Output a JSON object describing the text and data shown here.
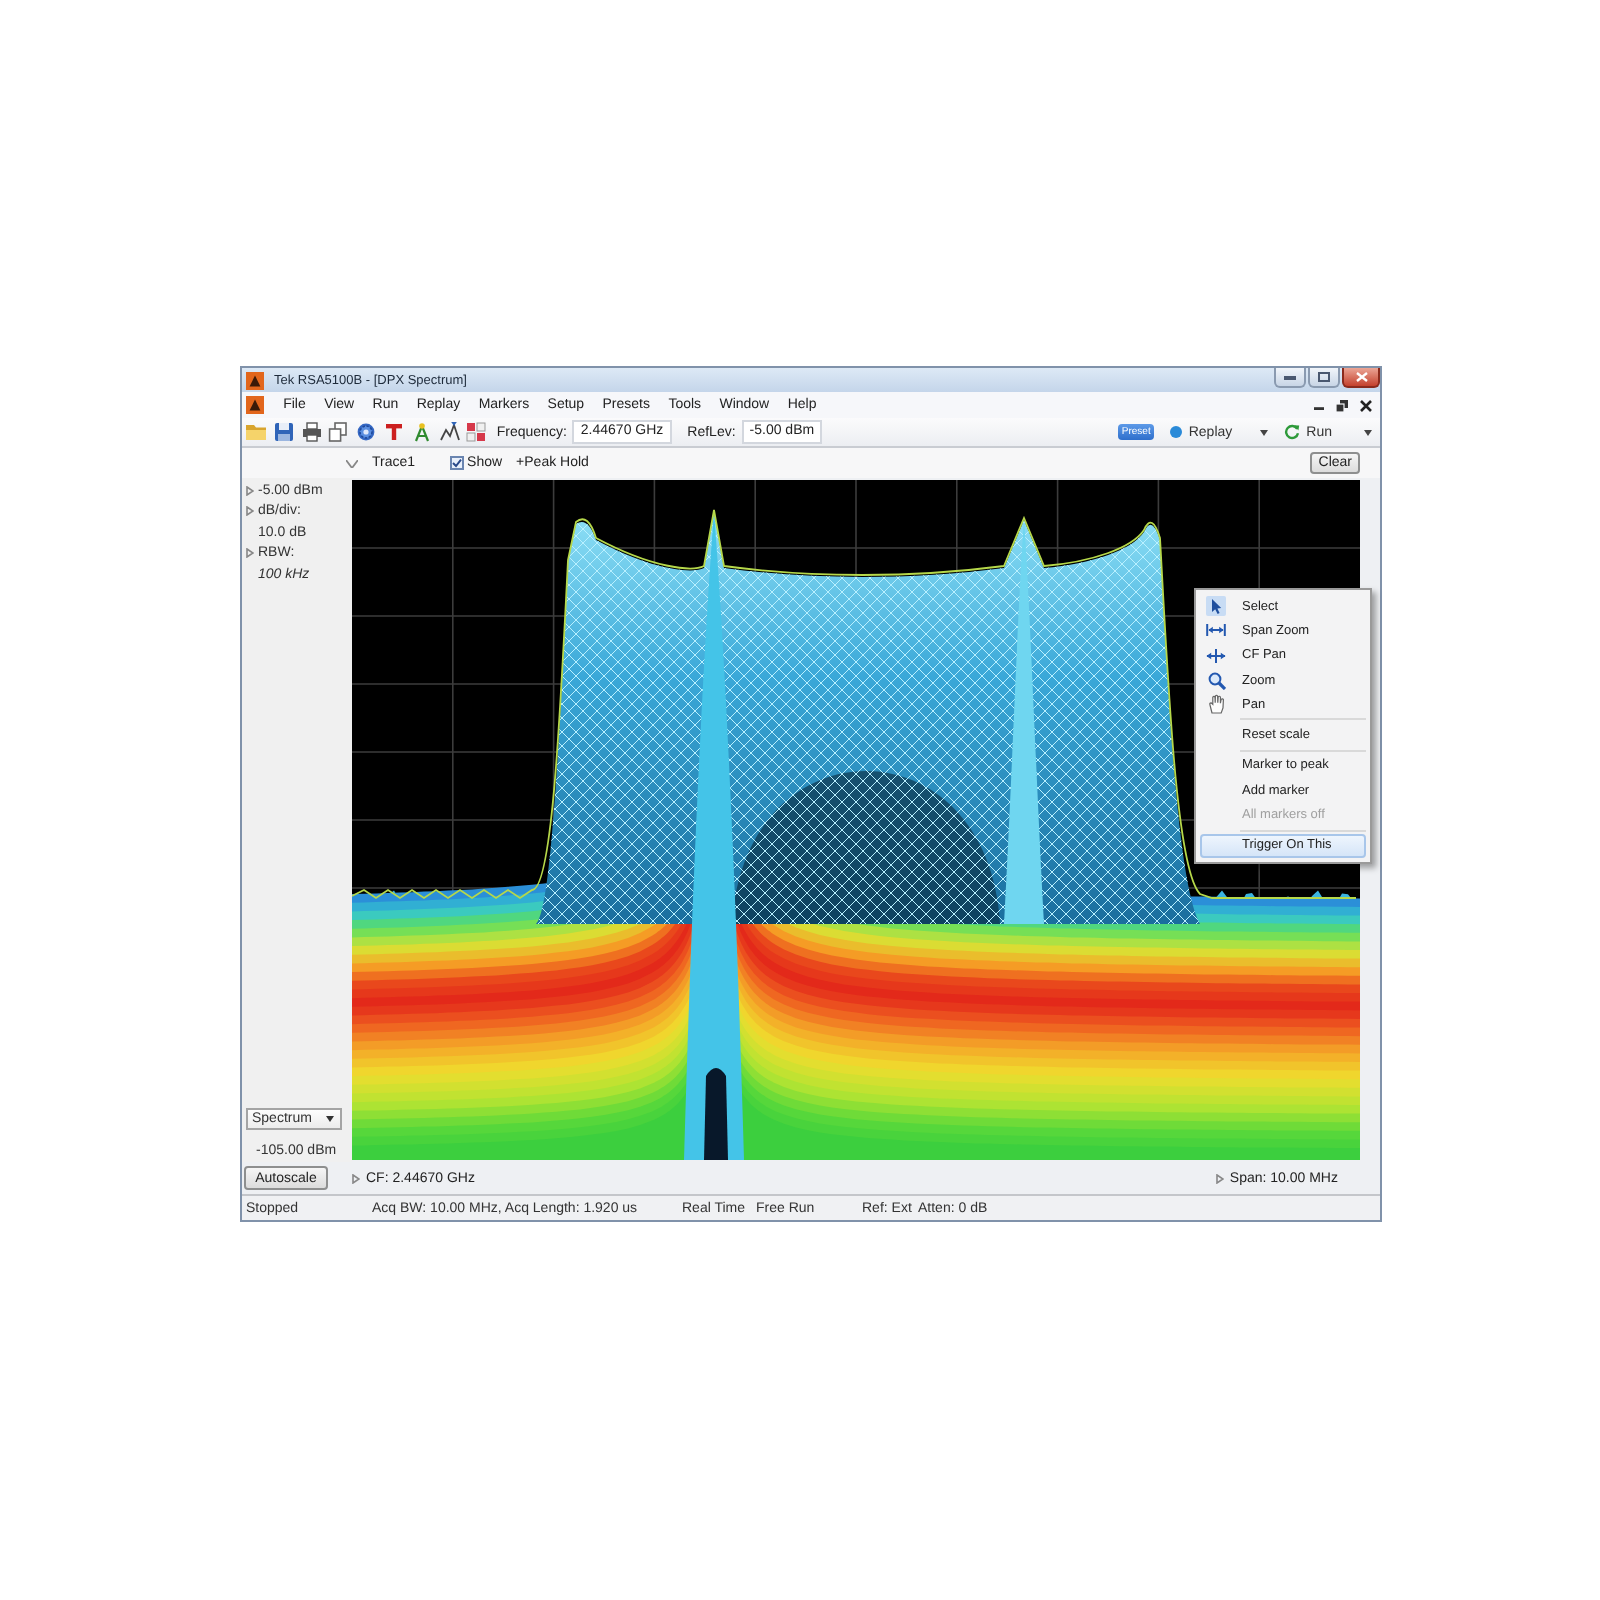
{
  "window": {
    "title": "Tek RSA5100B - [DPX Spectrum]"
  },
  "menu_bar": {
    "items": [
      "File",
      "View",
      "Run",
      "Replay",
      "Markers",
      "Setup",
      "Presets",
      "Tools",
      "Window",
      "Help"
    ]
  },
  "toolbar": {
    "frequency": {
      "label": "Frequency:",
      "value": "2.44670 GHz"
    },
    "ref_level": {
      "label": "RefLev:",
      "value": "-5.00 dBm"
    },
    "preset": "Preset",
    "replay": "Replay",
    "run": "Run"
  },
  "trace_bar": {
    "trace": "Trace1",
    "show": {
      "label": "Show",
      "checked": true
    },
    "function": "+Peak Hold",
    "clear": "Clear"
  },
  "side_panel": {
    "ref_level": "-5.00 dBm",
    "scale": {
      "label": "dB/div:",
      "value": "10.0 dB"
    },
    "rbw": {
      "label": "RBW:",
      "value": "100 kHz"
    },
    "display_menu": "Spectrum",
    "bottom_level": "-105.00 dBm"
  },
  "context_menu": {
    "groups": [
      [
        {
          "label": "Select",
          "disabled": false,
          "selected": false
        },
        {
          "label": "Span Zoom",
          "disabled": false,
          "selected": false
        },
        {
          "label": "CF Pan",
          "disabled": false,
          "selected": false
        },
        {
          "label": "Zoom",
          "disabled": false,
          "selected": false
        },
        {
          "label": "Pan",
          "disabled": false,
          "selected": false
        }
      ],
      [
        {
          "label": "Reset scale",
          "disabled": false,
          "selected": false
        }
      ],
      [
        {
          "label": "Marker to peak",
          "disabled": false,
          "selected": false
        },
        {
          "label": "Add marker",
          "disabled": false,
          "selected": false
        },
        {
          "label": "All markers off",
          "disabled": true,
          "selected": false
        }
      ],
      [
        {
          "label": "Trigger On This",
          "disabled": false,
          "selected": true
        }
      ]
    ]
  },
  "bottom_bar": {
    "autoscale": "Autoscale",
    "center_frequency": "CF: 2.44670 GHz",
    "span": "Span: 10.00 MHz"
  },
  "status_bar": {
    "items": [
      "Stopped",
      "Acq BW: 10.00 MHz, Acq Length: 1.920 us",
      "Real Time",
      "Free Run",
      "Ref: Ext",
      "Atten: 0 dB"
    ]
  }
}
